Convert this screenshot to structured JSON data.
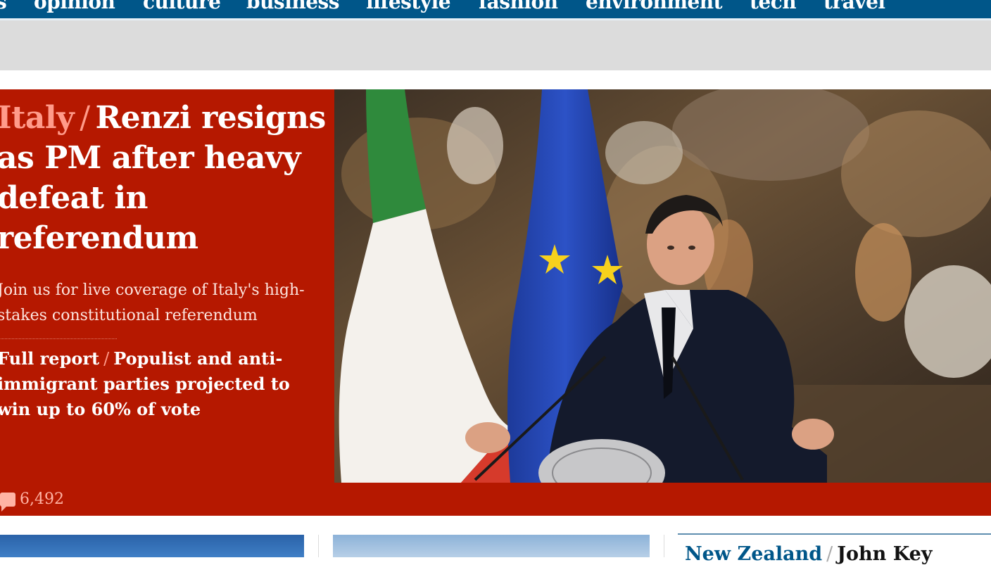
{
  "nav": {
    "items": [
      "opinion",
      "culture",
      "business",
      "lifestyle",
      "fashion",
      "environment",
      "tech",
      "travel"
    ],
    "color": "#005689"
  },
  "headline": {
    "kicker": "Italy",
    "title": "Renzi resigns as PM after heavy defeat in referendum",
    "standfirst": "Join us for live coverage of Italy's high-stakes constitutional referendum",
    "sublink_kicker": "Full report",
    "sublink_text": "Populist and anti-immigrant parties projected to win up to 60% of vote",
    "comment_count": "6,492",
    "background_color": "#b51800"
  },
  "image": {
    "icon": "photo-renzi-press-conference"
  },
  "cards": {
    "third_kicker": "New Zealand",
    "third_title": "John Key"
  }
}
